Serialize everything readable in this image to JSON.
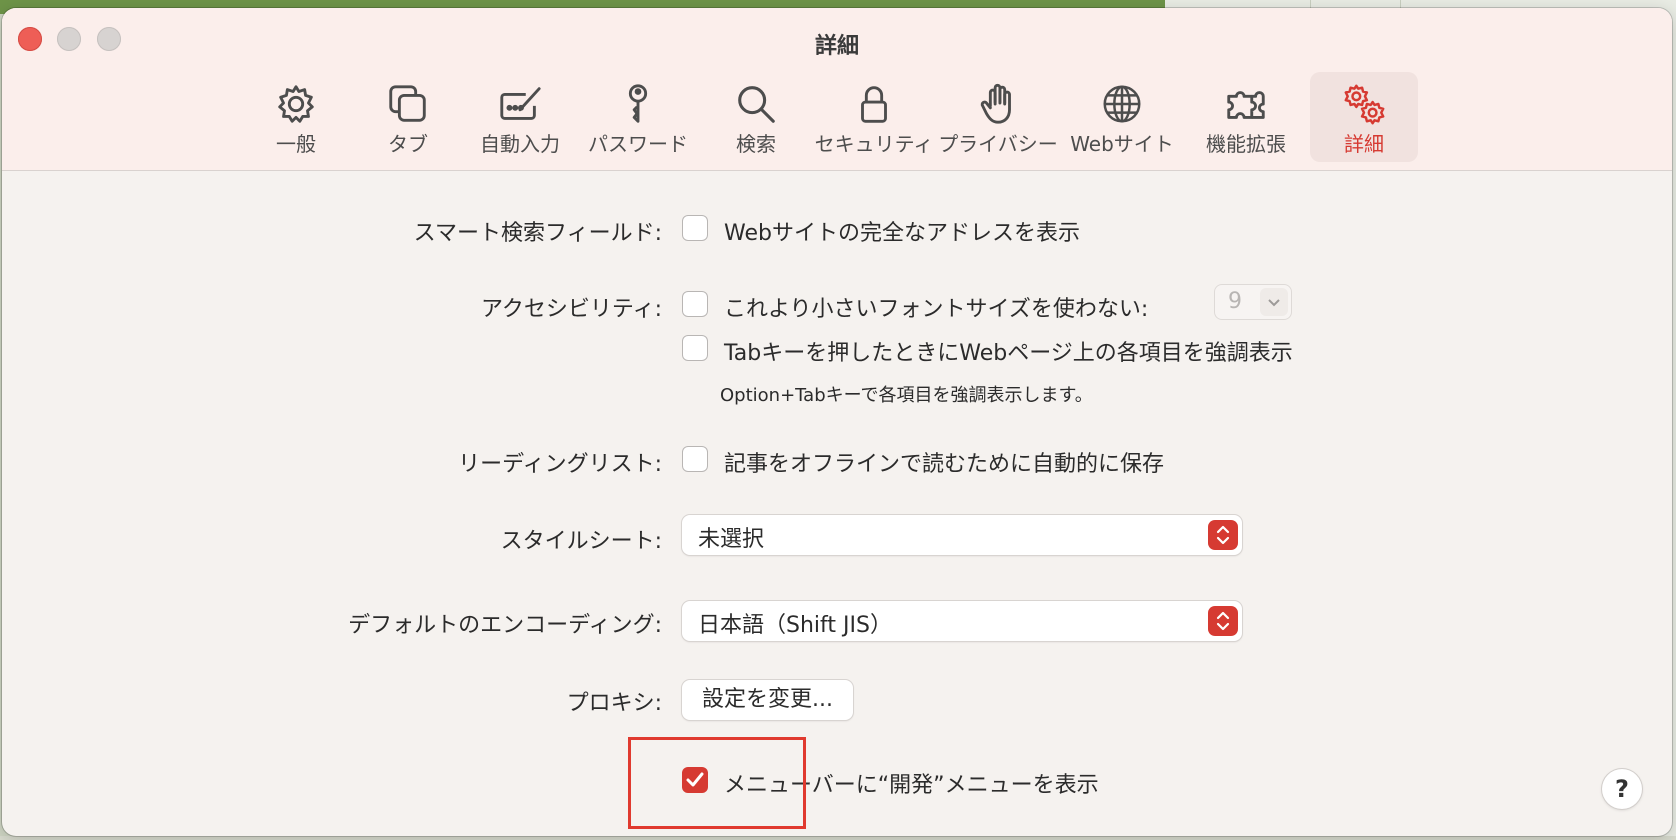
{
  "window": {
    "title": "詳細"
  },
  "toolbar": {
    "items": [
      {
        "label": "一般",
        "icon": "gear-icon"
      },
      {
        "label": "タブ",
        "icon": "tabs-icon"
      },
      {
        "label": "自動入力",
        "icon": "autofill-pen-icon"
      },
      {
        "label": "パスワード",
        "icon": "key-icon"
      },
      {
        "label": "検索",
        "icon": "magnifier-icon"
      },
      {
        "label": "セキュリティ",
        "icon": "lock-icon"
      },
      {
        "label": "プライバシー",
        "icon": "hand-icon"
      },
      {
        "label": "Webサイト",
        "icon": "globe-icon"
      },
      {
        "label": "機能拡張",
        "icon": "puzzle-icon"
      },
      {
        "label": "詳細",
        "icon": "gears-icon",
        "active": true
      }
    ]
  },
  "settings": {
    "smart_search": {
      "label": "スマート検索フィールド:",
      "option": "Webサイトの完全なアドレスを表示",
      "checked": false
    },
    "accessibility": {
      "label": "アクセシビリティ:",
      "font_option": "これより小さいフォントサイズを使わない:",
      "font_checked": false,
      "font_size": "9",
      "tab_option": "Tabキーを押したときにWebページ上の各項目を強調表示",
      "tab_checked": false,
      "tab_note": "Option+Tabキーで各項目を強調表示します。"
    },
    "reading_list": {
      "label": "リーディングリスト:",
      "option": "記事をオフラインで読むために自動的に保存",
      "checked": false
    },
    "stylesheet": {
      "label": "スタイルシート:",
      "value": "未選択"
    },
    "encoding": {
      "label": "デフォルトのエンコーディング:",
      "value": "日本語（Shift JIS）"
    },
    "proxy": {
      "label": "プロキシ:",
      "button": "設定を変更..."
    },
    "develop_menu": {
      "option": "メニューバーに“開発”メニューを表示",
      "checked": true
    }
  },
  "help": {
    "label": "?"
  },
  "colors": {
    "accent": "#d63a32",
    "highlight": "#e03a2f"
  }
}
